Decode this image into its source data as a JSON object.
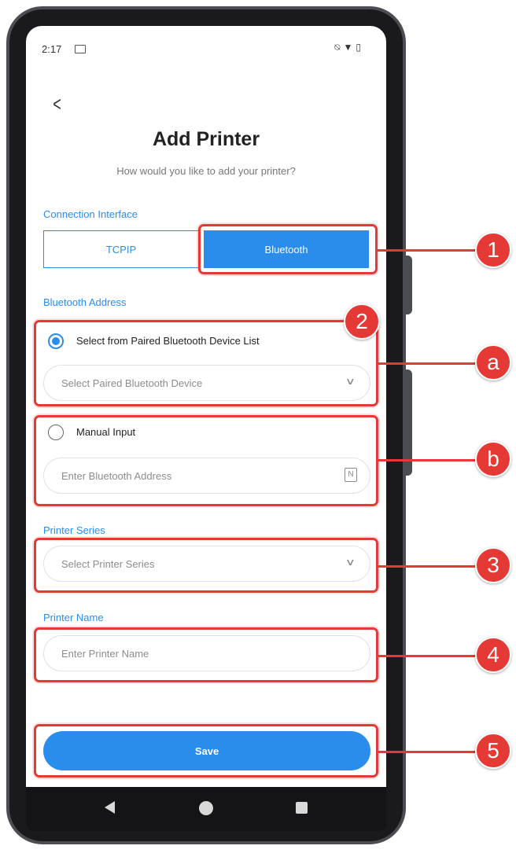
{
  "status_bar": {
    "time": "2:17",
    "icons": [
      "sim-card-icon",
      "mute-icon",
      "wifi-icon",
      "battery-icon"
    ]
  },
  "header": {
    "title": "Add Printer",
    "subtitle": "How would you like to add your printer?"
  },
  "connection": {
    "label": "Connection Interface",
    "options": [
      "TCPIP",
      "Bluetooth"
    ],
    "selected": "Bluetooth"
  },
  "bluetooth": {
    "label": "Bluetooth Address",
    "paired_option_label": "Select from Paired Bluetooth Device List",
    "paired_placeholder": "Select Paired Bluetooth Device",
    "manual_option_label": "Manual Input",
    "manual_placeholder": "Enter Bluetooth Address",
    "selected": "paired"
  },
  "printer_series": {
    "label": "Printer Series",
    "placeholder": "Select Printer Series"
  },
  "printer_name": {
    "label": "Printer Name",
    "placeholder": "Enter Printer Name"
  },
  "save_label": "Save",
  "callouts": [
    "1",
    "2",
    "a",
    "b",
    "3",
    "4",
    "5"
  ],
  "colors": {
    "accent": "#2a8dec",
    "annotation": "#e53935"
  }
}
